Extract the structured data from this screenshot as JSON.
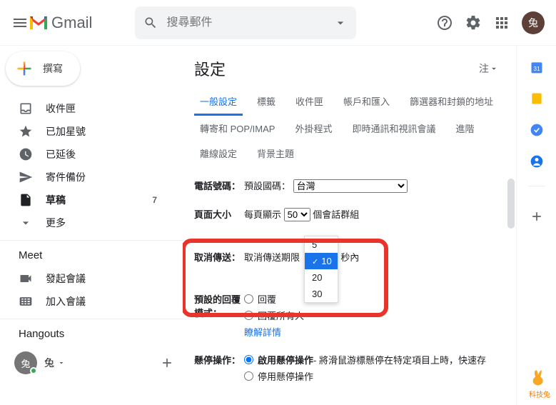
{
  "header": {
    "brand": "Gmail",
    "search_placeholder": "搜尋郵件",
    "avatar_text": "兔"
  },
  "compose": {
    "label": "撰寫"
  },
  "nav": {
    "inbox": "收件匣",
    "starred": "已加星號",
    "snoozed": "已延後",
    "sent": "寄件備份",
    "drafts": "草稿",
    "drafts_count": "7",
    "more": "更多"
  },
  "meet": {
    "title": "Meet",
    "start": "發起會議",
    "join": "加入會議"
  },
  "hangouts": {
    "title": "Hangouts",
    "user": "兔"
  },
  "settings": {
    "title": "設定",
    "note_label": "注",
    "tabs": {
      "general": "一般設定",
      "labels": "標籤",
      "inbox": "收件匣",
      "accounts": "帳戶和匯入",
      "filters": "篩選器和封鎖的地址",
      "forward": "轉寄和 POP/IMAP",
      "addons": "外掛程式",
      "chat": "即時通訊和視訊會議",
      "advanced": "進階",
      "offline": "離線設定",
      "themes": "背景主題"
    },
    "phone": {
      "label": "電話號碼：",
      "prefix": "預設國碼：",
      "value": "台灣"
    },
    "pagesize": {
      "label": "頁面大小",
      "before": "每頁顯示",
      "value": "50",
      "after": "個會話群組"
    },
    "undo": {
      "label": "取消傳送：",
      "text_before": "取消傳送期限",
      "text_after": "秒內",
      "options": [
        "5",
        "10",
        "20",
        "30"
      ],
      "selected": "10"
    },
    "reply": {
      "label": "預設的回覆模式：",
      "opt1": "回覆",
      "opt2": "回覆所有人",
      "learn": "瞭解詳情"
    },
    "hover": {
      "label": "懸停操作：",
      "opt1": "啟用懸停操作",
      "opt1_desc": " - 將滑鼠游標懸停在特定項目上時，快速存",
      "opt2": "停用懸停操作"
    }
  },
  "watermark": "科技兔"
}
